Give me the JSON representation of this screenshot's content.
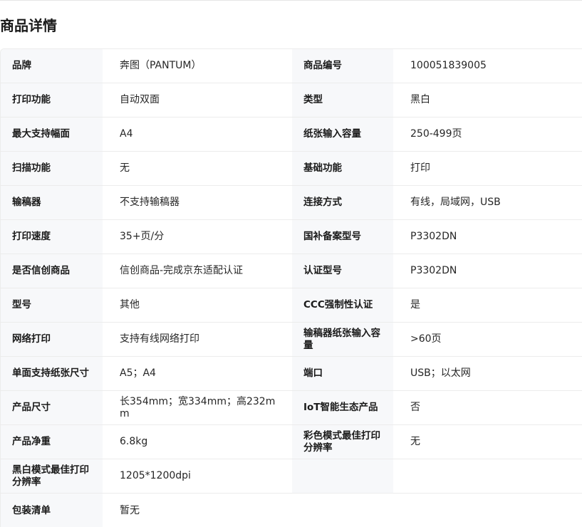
{
  "section": {
    "title": "商品详情"
  },
  "left_specs": [
    {
      "label": "品牌",
      "value": "奔图（PANTUM）"
    },
    {
      "label": "打印功能",
      "value": "自动双面"
    },
    {
      "label": "最大支持幅面",
      "value": "A4"
    },
    {
      "label": "扫描功能",
      "value": "无"
    },
    {
      "label": "输稿器",
      "value": "不支持输稿器"
    },
    {
      "label": "打印速度",
      "value": "35+页/分"
    },
    {
      "label": "是否信创商品",
      "value": "信创商品-完成京东适配认证"
    },
    {
      "label": "型号",
      "value": "其他"
    },
    {
      "label": "网络打印",
      "value": "支持有线网络打印"
    },
    {
      "label": "单面支持纸张尺寸",
      "value": "A5；A4"
    },
    {
      "label": "产品尺寸",
      "value": "长354mm；宽334mm；高232mm"
    },
    {
      "label": "产品净重",
      "value": "6.8kg"
    },
    {
      "label": "黑白模式最佳打印分辨率",
      "value": "1205*1200dpi"
    },
    {
      "label": "包装清单",
      "value": "暂无"
    }
  ],
  "right_specs": [
    {
      "label": "商品编号",
      "value": "100051839005"
    },
    {
      "label": "类型",
      "value": "黑白"
    },
    {
      "label": "纸张输入容量",
      "value": "250-499页"
    },
    {
      "label": "基础功能",
      "value": "打印"
    },
    {
      "label": "连接方式",
      "value": "有线，局域网，USB"
    },
    {
      "label": "国补备案型号",
      "value": "P3302DN"
    },
    {
      "label": "认证型号",
      "value": "P3302DN"
    },
    {
      "label": "CCC强制性认证",
      "value": "是"
    },
    {
      "label": "输稿器纸张输入容量",
      "value": ">60页"
    },
    {
      "label": "端口",
      "value": "USB；以太网"
    },
    {
      "label": "IoT智能生态产品",
      "value": "否"
    },
    {
      "label": "彩色模式最佳打印分辨率",
      "value": "无"
    }
  ]
}
